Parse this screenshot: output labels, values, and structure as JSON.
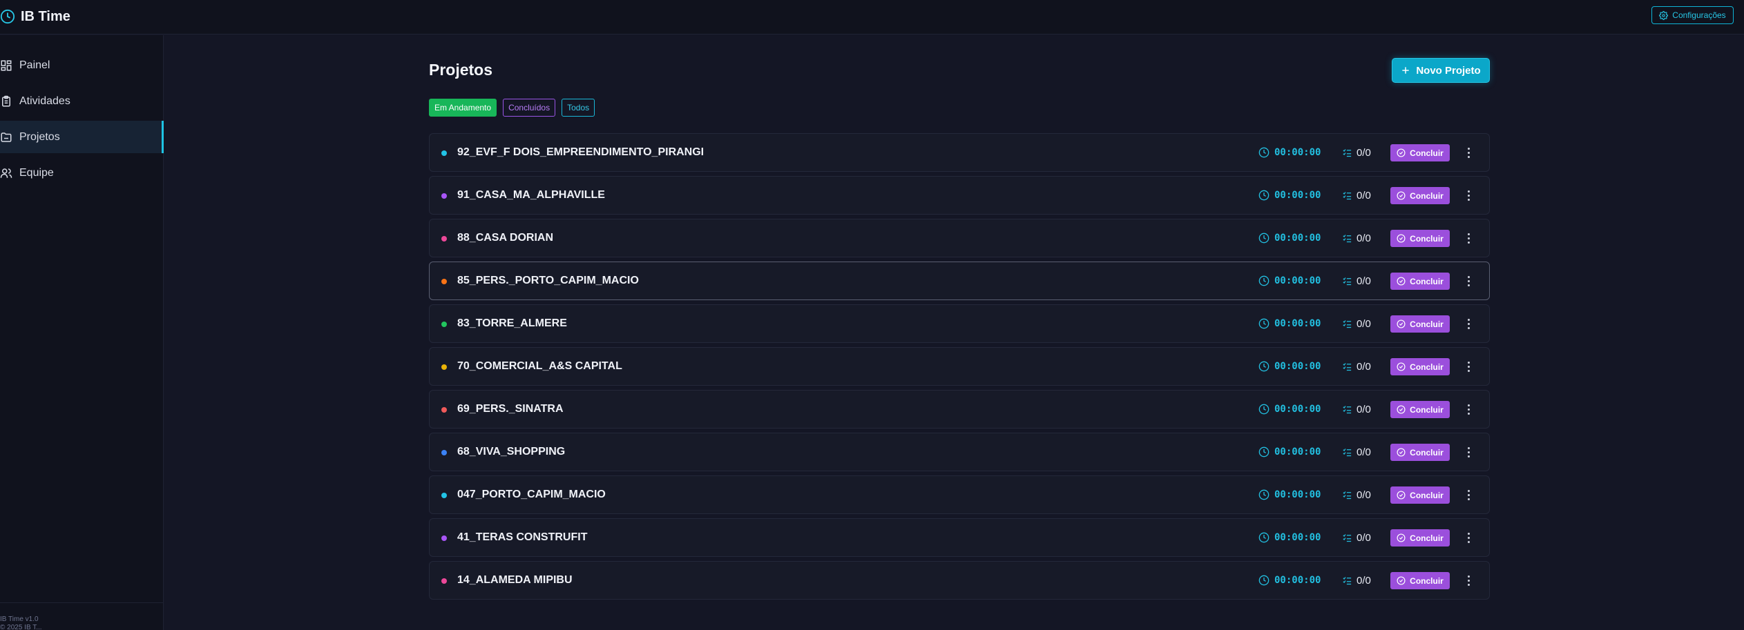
{
  "app": {
    "title": "IB Time"
  },
  "header": {
    "config_label": "Configurações"
  },
  "sidebar": {
    "items": [
      {
        "label": "Painel",
        "icon": "dashboard-icon"
      },
      {
        "label": "Atividades",
        "icon": "clipboard-icon"
      },
      {
        "label": "Projetos",
        "icon": "folder-icon",
        "active": true
      },
      {
        "label": "Equipe",
        "icon": "users-icon"
      }
    ],
    "footer_line1": "IB Time v1.0",
    "footer_line2": "© 2025 IB T..."
  },
  "main": {
    "title": "Projetos",
    "new_project_label": "Novo Projeto",
    "filters": [
      {
        "label": "Em Andamento",
        "color": "#18b659",
        "selected": true
      },
      {
        "label": "Concluídos",
        "color": "#9a55e6"
      },
      {
        "label": "Todos",
        "color": "#1ab8d8"
      }
    ],
    "conclude_label": "Concluir",
    "projects": [
      {
        "name": "92_EVF_F DOIS_EMPREENDIMENTO_PIRANGI",
        "dot_color": "#22c3e6",
        "time": "00:00:00",
        "tasks": "0/0"
      },
      {
        "name": "91_CASA_MA_ALPHAVILLE",
        "dot_color": "#a855f7",
        "time": "00:00:00",
        "tasks": "0/0"
      },
      {
        "name": "88_CASA DORIAN",
        "dot_color": "#ec4899",
        "time": "00:00:00",
        "tasks": "0/0"
      },
      {
        "name": "85_PERS._PORTO_CAPIM_MACIO",
        "dot_color": "#f97316",
        "time": "00:00:00",
        "tasks": "0/0"
      },
      {
        "name": "83_TORRE_ALMERE",
        "dot_color": "#22c55e",
        "time": "00:00:00",
        "tasks": "0/0"
      },
      {
        "name": "70_COMERCIAL_A&S CAPITAL",
        "dot_color": "#eab308",
        "time": "00:00:00",
        "tasks": "0/0"
      },
      {
        "name": "69_PERS._SINATRA",
        "dot_color": "#f05a5a",
        "time": "00:00:00",
        "tasks": "0/0"
      },
      {
        "name": "68_VIVA_SHOPPING",
        "dot_color": "#3b82f6",
        "time": "00:00:00",
        "tasks": "0/0"
      },
      {
        "name": "047_PORTO_CAPIM_MACIO",
        "dot_color": "#22c3e6",
        "time": "00:00:00",
        "tasks": "0/0"
      },
      {
        "name": "41_TERAS CONSTRUFIT",
        "dot_color": "#a855f7",
        "time": "00:00:00",
        "tasks": "0/0"
      },
      {
        "name": "14_ALAMEDA MIPIBU",
        "dot_color": "#ec4899",
        "time": "00:00:00",
        "tasks": "0/0"
      }
    ]
  }
}
